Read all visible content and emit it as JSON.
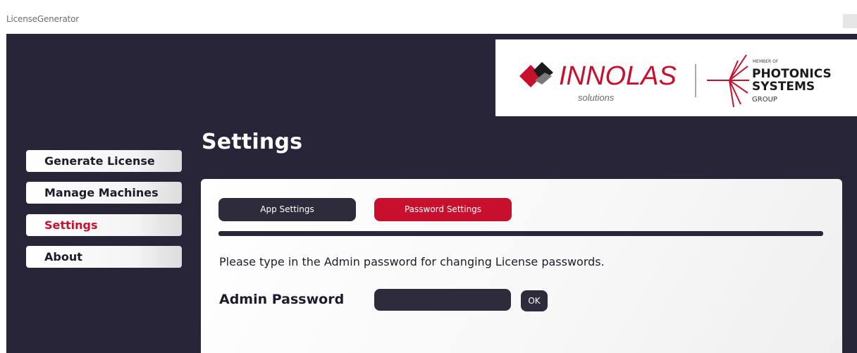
{
  "window": {
    "title": "LicenseGenerator"
  },
  "logo": {
    "brand": "INNOLAS",
    "brand_sub": "solutions",
    "member_of": "MEMBER OF",
    "group_line1": "PHOTONICS",
    "group_line2": "SYSTEMS",
    "group_line3": "GROUP"
  },
  "sidebar": {
    "items": [
      {
        "label": "Generate License",
        "active": false
      },
      {
        "label": "Manage Machines",
        "active": false
      },
      {
        "label": "Settings",
        "active": true
      },
      {
        "label": "About",
        "active": false
      }
    ]
  },
  "page": {
    "title": "Settings"
  },
  "settings": {
    "tabs": [
      {
        "label": "App Settings",
        "active": false
      },
      {
        "label": "Password Settings",
        "active": true
      }
    ],
    "instruction": "Please type in the Admin password for changing License passwords.",
    "admin_password_label": "Admin Password",
    "admin_password_value": "",
    "ok_label": "OK"
  },
  "colors": {
    "background": "#272537",
    "accent": "#c8102e",
    "dark_control": "#2e2c3a",
    "text_dark": "#1e1c2c"
  }
}
